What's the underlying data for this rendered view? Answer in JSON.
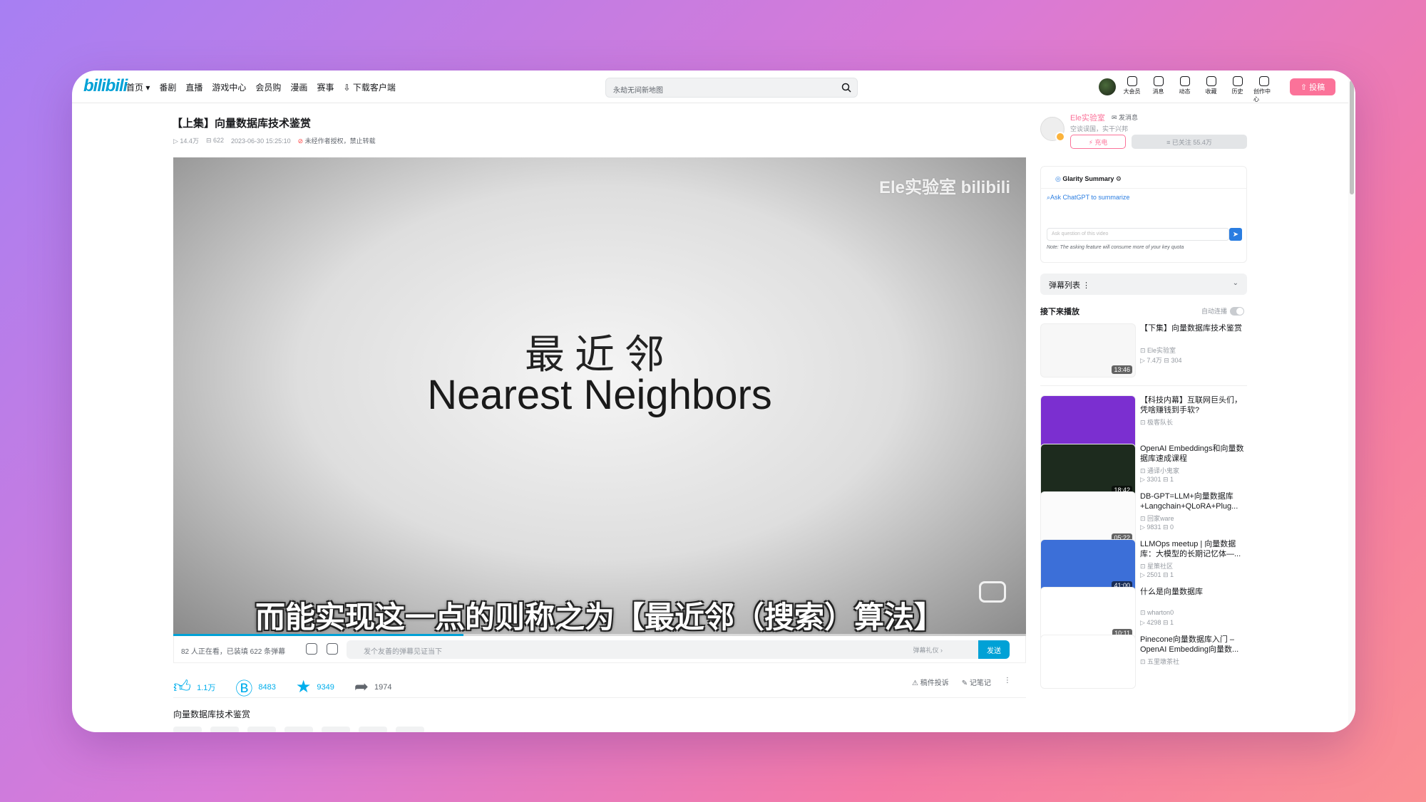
{
  "header": {
    "logo": "bilibili",
    "nav": [
      "首页 ▾",
      "番剧",
      "直播",
      "游戏中心",
      "会员购",
      "漫画",
      "赛事",
      "⇩ 下载客户端"
    ],
    "search_placeholder": "永劫无间新地图",
    "icons": [
      {
        "label": "大会员",
        "icon": "vip-icon"
      },
      {
        "label": "消息",
        "icon": "message-icon"
      },
      {
        "label": "动态",
        "icon": "dynamic-icon"
      },
      {
        "label": "收藏",
        "icon": "favorite-icon"
      },
      {
        "label": "历史",
        "icon": "history-icon"
      },
      {
        "label": "创作中心",
        "icon": "creator-icon"
      }
    ],
    "upload_label": "⇧ 投稿"
  },
  "video": {
    "title": "【上集】向量数据库技术鉴赏",
    "views": "14.4万",
    "danmaku": "622",
    "date": "2023-06-30 15:25:10",
    "rights": "未经作者授权，禁止转载",
    "watermark": "Ele实验室 bilibili",
    "frame_title_cn": "最近邻",
    "frame_title_en": "Nearest Neighbors",
    "subtitle": "而能实现这一点的则称之为【最近邻（搜索）算法】"
  },
  "danmaku_bar": {
    "count_text": "82 人正在看，已装填 622 条弹幕",
    "input_placeholder": "发个友善的弹幕见证当下",
    "etiquette": "弹幕礼仪 ›",
    "send_label": "发送"
  },
  "actions": {
    "like": "1.1万",
    "coin": "8483",
    "favorite": "9349",
    "share": "1974",
    "report": "稿件投诉",
    "note": "记笔记"
  },
  "description": "向量数据库技术鉴赏",
  "uploader": {
    "name": "Ele实验室",
    "message": "✉ 发消息",
    "sign": "空谈误国，实干兴邦",
    "charge": "⚡ 充电",
    "follow": "≡ 已关注 55.4万"
  },
  "glarity": {
    "title": "Glarity Summary ⚙",
    "ask_label": "Ask ChatGPT to summarize",
    "input_placeholder": "Ask question of this video",
    "note": "Note: The asking feature will consume more of your key quota"
  },
  "danmaku_list_label": "弹幕列表 ⋮",
  "next_label": "接下来播放",
  "autoplay_label": "自动连播",
  "recommendations": [
    {
      "title": "【下集】向量数据库技术鉴赏",
      "author": "Ele实验室",
      "stats": "▷ 7.4万  ⊟ 304",
      "duration": "13:46",
      "color": "#f7f7f7"
    },
    {
      "title": "【科技内幕】互联网巨头们，凭啥赚钱到手软?",
      "author": "极客队长",
      "stats": "",
      "duration": "",
      "color": "#7b2fd0"
    },
    {
      "title": "OpenAI Embeddings和向量数据库速成课程",
      "author": "通译小鬼家",
      "stats": "▷ 3301  ⊟ 1",
      "duration": "18:42",
      "color": "#1d2b1e"
    },
    {
      "title": "DB-GPT=LLM+向量数据库+Langchain+QLoRA+Plug...",
      "author": "回家ware",
      "stats": "▷ 9831  ⊟ 0",
      "duration": "05:22",
      "color": "#fbfbfb"
    },
    {
      "title": "LLMOps meetup | 向量数据库：大模型的长期记忆体—...",
      "author": "星策社区",
      "stats": "▷ 2501  ⊟ 1",
      "duration": "41:00",
      "color": "#3c6fd8"
    },
    {
      "title": "什么是向量数据库",
      "author": "wharton0",
      "stats": "▷ 4298  ⊟ 1",
      "duration": "10:11",
      "color": "#ffffff"
    },
    {
      "title": "Pinecone向量数据库入门 – OpenAI Embedding向量数...",
      "author": "五里墩茶社",
      "stats": "",
      "duration": "",
      "color": "#ffffff"
    }
  ]
}
